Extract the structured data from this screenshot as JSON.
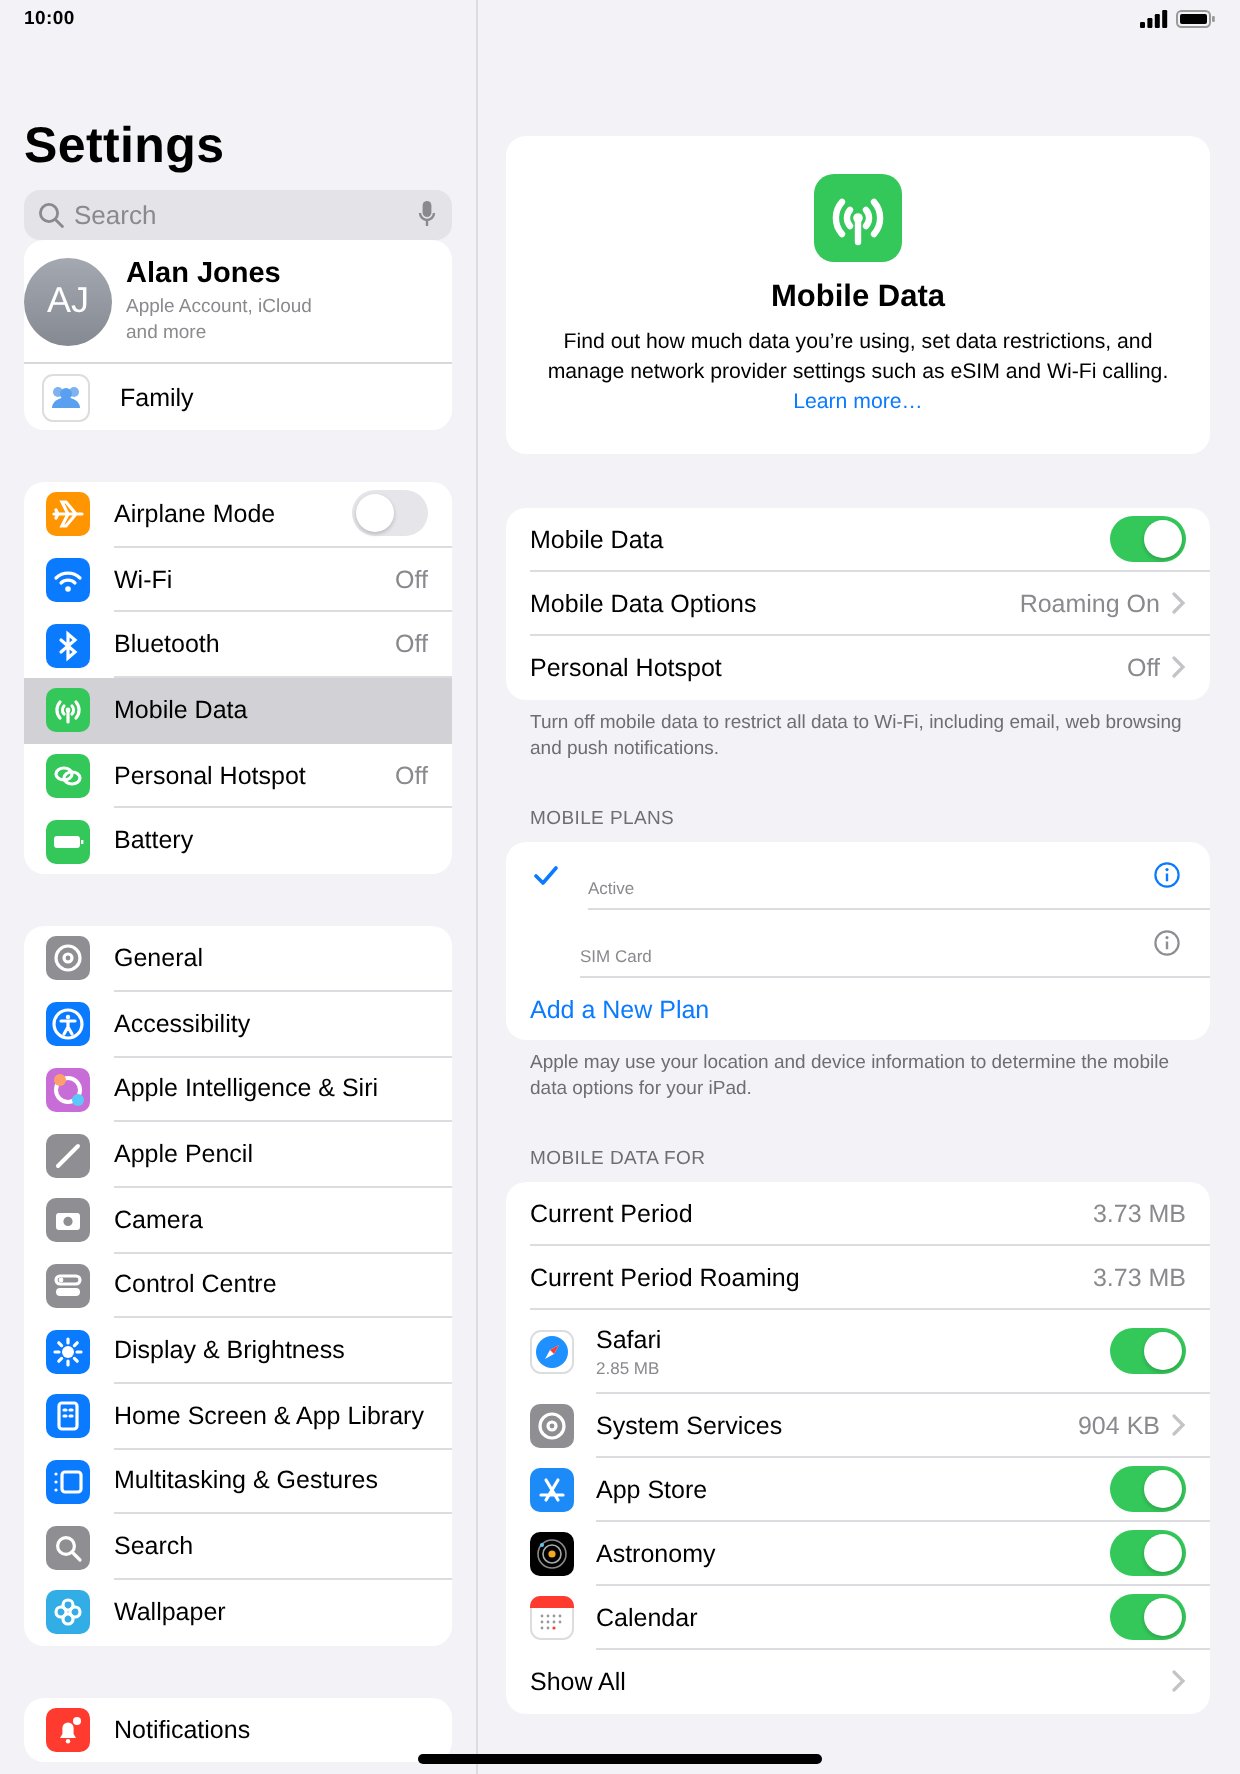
{
  "status_bar": {
    "time": "10:00"
  },
  "sidebar": {
    "title": "Settings",
    "search": {
      "placeholder": "Search"
    },
    "profile": {
      "initials": "AJ",
      "name": "Alan Jones",
      "subtitle": "Apple Account, iCloud and more"
    },
    "family": {
      "label": "Family"
    },
    "groups": [
      {
        "items": [
          {
            "label": "Airplane Mode",
            "kind": "toggle",
            "on": false,
            "selected": false
          },
          {
            "label": "Wi-Fi",
            "kind": "value",
            "value": "Off",
            "selected": false
          },
          {
            "label": "Bluetooth",
            "kind": "value",
            "value": "Off",
            "selected": false
          },
          {
            "label": "Mobile Data",
            "kind": "plain",
            "selected": true
          },
          {
            "label": "Personal Hotspot",
            "kind": "value",
            "value": "Off",
            "selected": false
          },
          {
            "label": "Battery",
            "kind": "plain",
            "selected": false
          }
        ]
      },
      {
        "items": [
          {
            "label": "General",
            "kind": "plain",
            "selected": false
          },
          {
            "label": "Accessibility",
            "kind": "plain",
            "selected": false
          },
          {
            "label": "Apple Intelligence & Siri",
            "kind": "plain",
            "selected": false
          },
          {
            "label": "Apple Pencil",
            "kind": "plain",
            "selected": false
          },
          {
            "label": "Camera",
            "kind": "plain",
            "selected": false
          },
          {
            "label": "Control Centre",
            "kind": "plain",
            "selected": false
          },
          {
            "label": "Display & Brightness",
            "kind": "plain",
            "selected": false
          },
          {
            "label": "Home Screen & App Library",
            "kind": "plain",
            "selected": false
          },
          {
            "label": "Multitasking & Gestures",
            "kind": "plain",
            "selected": false
          },
          {
            "label": "Search",
            "kind": "plain",
            "selected": false
          },
          {
            "label": "Wallpaper",
            "kind": "plain",
            "selected": false
          }
        ]
      },
      {
        "items": [
          {
            "label": "Notifications",
            "kind": "plain",
            "selected": false
          }
        ]
      }
    ]
  },
  "detail": {
    "header": {
      "title": "Mobile Data",
      "description": "Find out how much data you’re using, set data restrictions, and manage network provider settings such as eSIM and Wi-Fi calling.",
      "link": "Learn more…"
    },
    "sections": [
      {
        "rows": [
          {
            "kind": "toggle",
            "label": "Mobile Data",
            "on": true
          },
          {
            "kind": "value",
            "label": "Mobile Data Options",
            "value": "Roaming On"
          },
          {
            "kind": "value",
            "label": "Personal Hotspot",
            "value": "Off"
          }
        ],
        "footer": "Turn off mobile data to restrict all data to Wi-Fi, including email, web browsing and push notifications."
      },
      {
        "header": "MOBILE PLANS",
        "rows": [
          {
            "kind": "plan",
            "status": "Active",
            "selected": true
          },
          {
            "kind": "plan",
            "status": "SIM Card",
            "selected": false
          },
          {
            "kind": "action",
            "label": "Add a New Plan"
          }
        ],
        "footer": "Apple may use your location and device information to determine the mobile data options for your iPad."
      },
      {
        "header": "MOBILE DATA FOR",
        "rows": [
          {
            "kind": "stat",
            "label": "Current Period",
            "value": "3.73 MB"
          },
          {
            "kind": "stat",
            "label": "Current Period Roaming",
            "value": "3.73 MB"
          },
          {
            "kind": "app-toggle",
            "label": "Safari",
            "detail": "2.85 MB",
            "on": true
          },
          {
            "kind": "app-value",
            "label": "System Services",
            "value": "904 KB"
          },
          {
            "kind": "app-toggle",
            "label": "App Store",
            "on": true
          },
          {
            "kind": "app-toggle",
            "label": "Astronomy",
            "on": true
          },
          {
            "kind": "app-toggle",
            "label": "Calendar",
            "on": true
          },
          {
            "kind": "link",
            "label": "Show All"
          }
        ]
      }
    ]
  }
}
